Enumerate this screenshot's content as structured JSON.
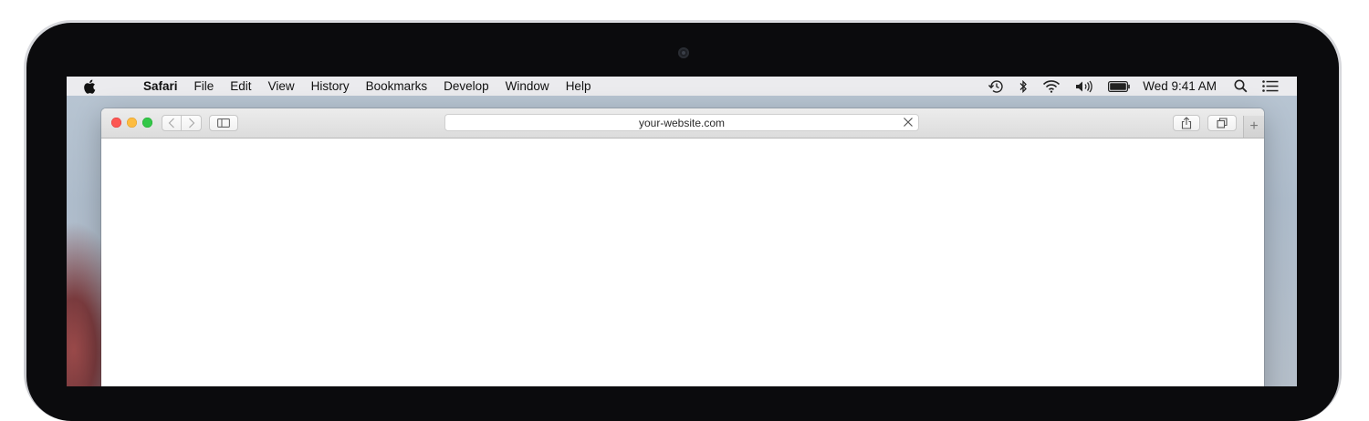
{
  "menubar": {
    "apple_icon": "apple-logo-icon",
    "items": [
      "Safari",
      "File",
      "Edit",
      "View",
      "History",
      "Bookmarks",
      "Develop",
      "Window",
      "Help"
    ],
    "status_icons": [
      "time-machine-icon",
      "bluetooth-icon",
      "wifi-icon",
      "volume-icon",
      "battery-icon"
    ],
    "clock": "Wed 9:41 AM",
    "spotlight_icon": "search-icon",
    "notifications_icon": "notification-center-icon"
  },
  "browser": {
    "address": "your-website.com",
    "new_tab_label": "+",
    "traffic_lights": {
      "close": "#fc5753",
      "minimize": "#fdbc40",
      "zoom": "#33c748"
    }
  }
}
